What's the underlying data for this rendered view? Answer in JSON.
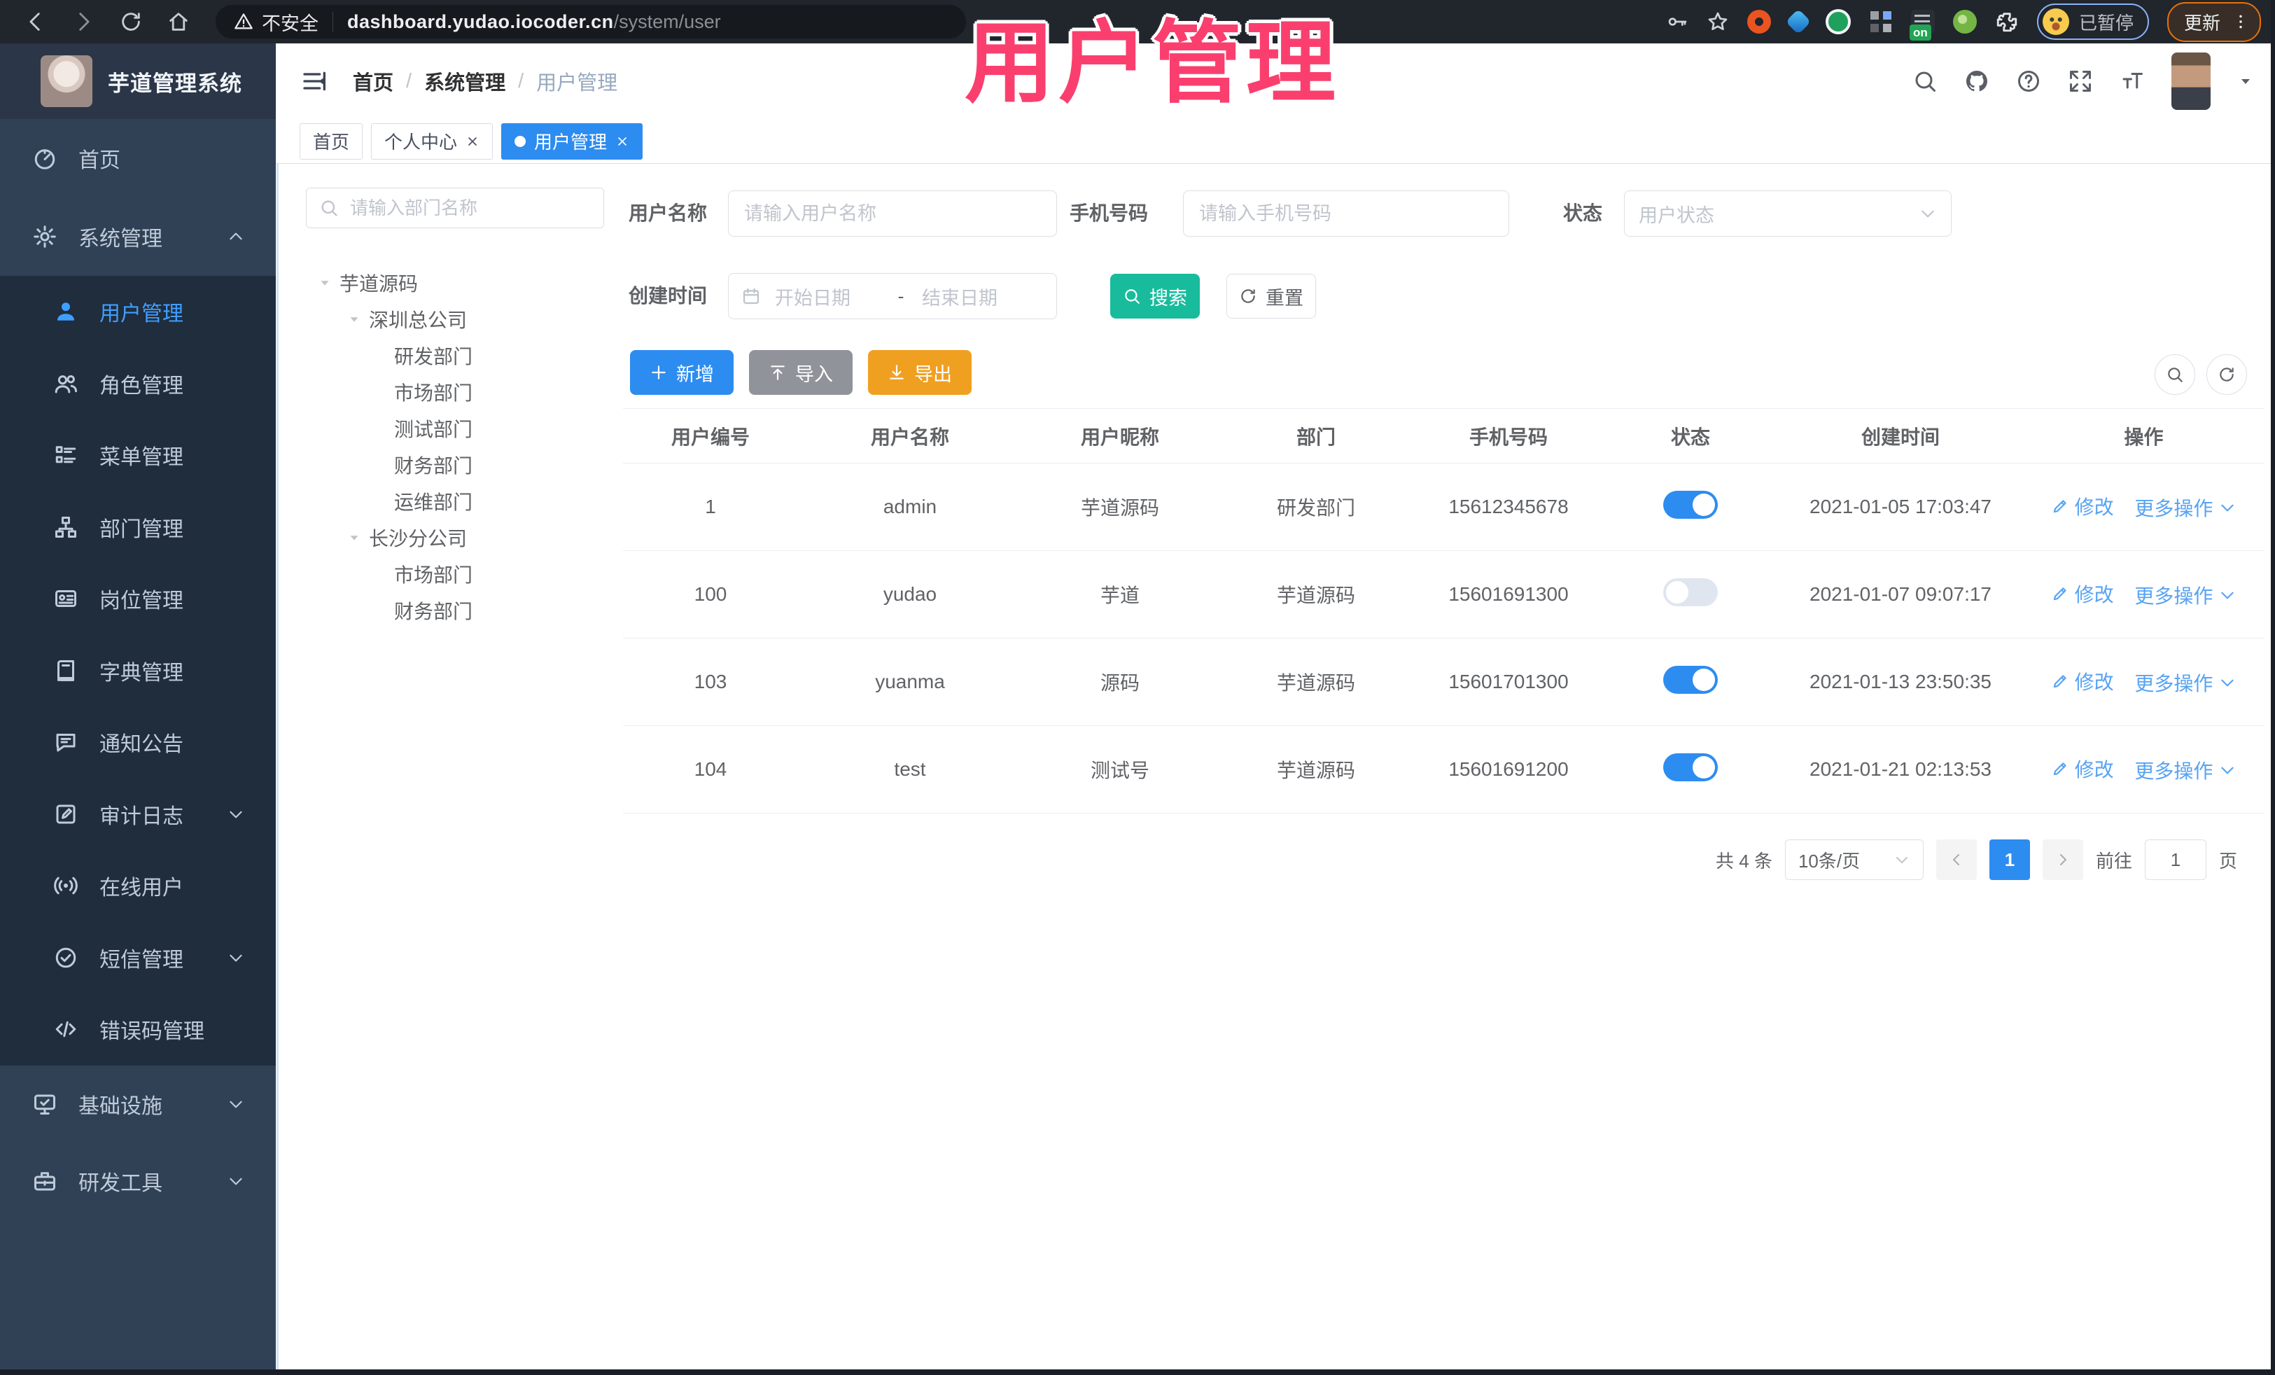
{
  "browser": {
    "security_label": "不安全",
    "url_domain": "dashboard.yudao.iocoder.cn",
    "url_path": "/system/user",
    "ext_badge": "on",
    "paused_label": "已暂停",
    "update_label": "更新"
  },
  "watermark": "用户管理",
  "header": {
    "title": "芋道管理系统",
    "breadcrumb": [
      "首页",
      "系统管理",
      "用户管理"
    ]
  },
  "tabs": [
    {
      "label": "首页"
    },
    {
      "label": "个人中心"
    },
    {
      "label": "用户管理"
    }
  ],
  "sidebar": {
    "items": [
      {
        "label": "首页"
      },
      {
        "label": "系统管理"
      },
      {
        "label": "用户管理"
      },
      {
        "label": "角色管理"
      },
      {
        "label": "菜单管理"
      },
      {
        "label": "部门管理"
      },
      {
        "label": "岗位管理"
      },
      {
        "label": "字典管理"
      },
      {
        "label": "通知公告"
      },
      {
        "label": "审计日志"
      },
      {
        "label": "在线用户"
      },
      {
        "label": "短信管理"
      },
      {
        "label": "错误码管理"
      },
      {
        "label": "基础设施"
      },
      {
        "label": "研发工具"
      }
    ]
  },
  "dept": {
    "search_placeholder": "请输入部门名称",
    "nodes": [
      {
        "label": "芋道源码"
      },
      {
        "label": "深圳总公司"
      },
      {
        "label": "研发部门"
      },
      {
        "label": "市场部门"
      },
      {
        "label": "测试部门"
      },
      {
        "label": "财务部门"
      },
      {
        "label": "运维部门"
      },
      {
        "label": "长沙分公司"
      },
      {
        "label": "市场部门"
      },
      {
        "label": "财务部门"
      }
    ]
  },
  "filters": {
    "username_label": "用户名称",
    "username_placeholder": "请输入用户名称",
    "mobile_label": "手机号码",
    "mobile_placeholder": "请输入手机号码",
    "status_label": "状态",
    "status_placeholder": "用户状态",
    "ctime_label": "创建时间",
    "date_start_placeholder": "开始日期",
    "date_separator": "-",
    "date_end_placeholder": "结束日期",
    "search_label": "搜索",
    "reset_label": "重置"
  },
  "toolbar": {
    "add_label": "新增",
    "import_label": "导入",
    "export_label": "导出"
  },
  "table": {
    "columns": [
      "用户编号",
      "用户名称",
      "用户昵称",
      "部门",
      "手机号码",
      "状态",
      "创建时间",
      "操作"
    ],
    "op_edit": "修改",
    "op_more": "更多操作",
    "rows": [
      {
        "id": "1",
        "username": "admin",
        "nickname": "芋道源码",
        "dept": "研发部门",
        "mobile": "15612345678",
        "status": "on",
        "created": "2021-01-05 17:03:47"
      },
      {
        "id": "100",
        "username": "yudao",
        "nickname": "芋道",
        "dept": "芋道源码",
        "mobile": "15601691300",
        "status": "off",
        "created": "2021-01-07 09:07:17"
      },
      {
        "id": "103",
        "username": "yuanma",
        "nickname": "源码",
        "dept": "芋道源码",
        "mobile": "15601701300",
        "status": "on",
        "created": "2021-01-13 23:50:35"
      },
      {
        "id": "104",
        "username": "test",
        "nickname": "测试号",
        "dept": "芋道源码",
        "mobile": "15601691200",
        "status": "on",
        "created": "2021-01-21 02:13:53"
      }
    ]
  },
  "pagination": {
    "total": "共 4 条",
    "page_size": "10条/页",
    "current": "1",
    "goto_label": "前往",
    "goto_value": "1",
    "page_unit": "页"
  },
  "colors": {
    "primary_blue": "#2d8cf0",
    "active_menu": "#409eff",
    "search_teal": "#18bc9c",
    "export_amber": "#f0a020",
    "import_gray": "#909399",
    "sidebar_bg": "#304156",
    "submenu_bg": "#1f2d3d",
    "watermark_pink": "#fa3f6e",
    "link_blue": "#57a3f3"
  }
}
